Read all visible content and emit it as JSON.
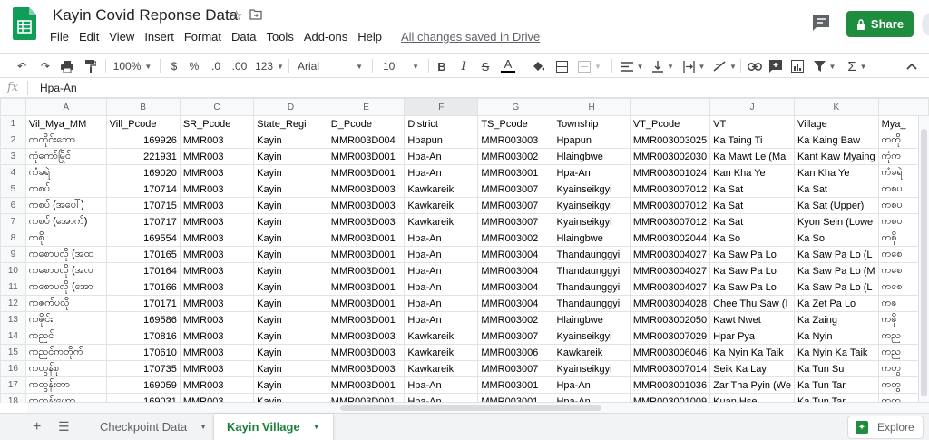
{
  "header": {
    "title": "Kayin Covid Reponse Data",
    "menu": [
      "File",
      "Edit",
      "View",
      "Insert",
      "Format",
      "Data",
      "Tools",
      "Add-ons",
      "Help"
    ],
    "saved_status": "All changes saved in Drive",
    "share_label": "Share",
    "icons": [
      "star-icon",
      "move-folder-icon",
      "comment-icon",
      "lock-icon"
    ]
  },
  "toolbar": {
    "zoom": "100%",
    "currency": "$",
    "percent": "%",
    "decrease_decimal": ".0",
    "increase_decimal": ".00",
    "more_formats": "123",
    "font": "Arial",
    "font_size": "10",
    "bold": "B",
    "italic": "I",
    "strike": "S",
    "text_color": "A",
    "functions": "Σ"
  },
  "formula_bar": {
    "fx_label": "fx",
    "value": "Hpa-An"
  },
  "grid": {
    "column_letters": [
      "A",
      "B",
      "C",
      "D",
      "E",
      "F",
      "G",
      "H",
      "I",
      "J",
      "K",
      ""
    ],
    "selected_column": "F",
    "row_numbers": [
      "1",
      "2",
      "3",
      "4",
      "5",
      "6",
      "7",
      "8",
      "9",
      "10",
      "11",
      "12",
      "13",
      "14",
      "15",
      "16",
      "17",
      "18"
    ],
    "rows": [
      [
        "Vil_Mya_MM",
        "Vill_Pcode",
        "SR_Pcode",
        "State_Regi",
        "D_Pcode",
        "District",
        "TS_Pcode",
        "Township",
        "VT_Pcode",
        "VT",
        "Village",
        "Mya_"
      ],
      [
        "ကကိုင်းဘော",
        "169926",
        "MMR003",
        "Kayin",
        "MMR003D004",
        "Hpapun",
        "MMR003003",
        "Hpapun",
        "MMR003003025",
        "Ka Taing Ti",
        "Ka Kaing Baw",
        "ကကို"
      ],
      [
        "ကုံကော်မြိုင်",
        "221931",
        "MMR003",
        "Kayin",
        "MMR003D001",
        "Hpa-An",
        "MMR003002",
        "Hlaingbwe",
        "MMR003002030",
        "Ka Mawt Le (Ma",
        "Kant Kaw Myaing",
        "ကုံက"
      ],
      [
        "ကံခရဲ",
        "169020",
        "MMR003",
        "Kayin",
        "MMR003D001",
        "Hpa-An",
        "MMR003001",
        "Hpa-An",
        "MMR003001024",
        "Kan Kha Ye",
        "Kan Kha Ye",
        "ကံခရဲ"
      ],
      [
        "ကစပ်",
        "170714",
        "MMR003",
        "Kayin",
        "MMR003D003",
        "Kawkareik",
        "MMR003007",
        "Kyainseikgyi",
        "MMR003007012",
        "Ka Sat",
        "Ka Sat",
        "ကစပ"
      ],
      [
        "ကစပ် (အပေါ်)",
        "170715",
        "MMR003",
        "Kayin",
        "MMR003D003",
        "Kawkareik",
        "MMR003007",
        "Kyainseikgyi",
        "MMR003007012",
        "Ka Sat",
        "Ka Sat (Upper)",
        "ကစပ"
      ],
      [
        "ကစပ် (အောက်)",
        "170717",
        "MMR003",
        "Kayin",
        "MMR003D003",
        "Kawkareik",
        "MMR003007",
        "Kyainseikgyi",
        "MMR003007012",
        "Ka Sat",
        "Kyon Sein (Lowe",
        "ကစပ"
      ],
      [
        "ကစို",
        "169554",
        "MMR003",
        "Kayin",
        "MMR003D001",
        "Hpa-An",
        "MMR003002",
        "Hlaingbwe",
        "MMR003002044",
        "Ka So",
        "Ka So",
        "ကစို"
      ],
      [
        "ကစောပလို (အထ",
        "170165",
        "MMR003",
        "Kayin",
        "MMR003D001",
        "Hpa-An",
        "MMR003004",
        "Thandaunggyi",
        "MMR003004027",
        "Ka Saw Pa Lo",
        "Ka Saw Pa Lo (L",
        "ကစေ"
      ],
      [
        "ကစောပလို (အလ",
        "170164",
        "MMR003",
        "Kayin",
        "MMR003D001",
        "Hpa-An",
        "MMR003004",
        "Thandaunggyi",
        "MMR003004027",
        "Ka Saw Pa Lo",
        "Ka Saw Pa Lo (M",
        "ကစေ"
      ],
      [
        "ကစောပလို (အော",
        "170166",
        "MMR003",
        "Kayin",
        "MMR003D001",
        "Hpa-An",
        "MMR003004",
        "Thandaunggyi",
        "MMR003004027",
        "Ka Saw Pa Lo",
        "Ka Saw Pa Lo (L",
        "ကစေ"
      ],
      [
        "ကဇက်ပလို",
        "170171",
        "MMR003",
        "Kayin",
        "MMR003D001",
        "Hpa-An",
        "MMR003004",
        "Thandaunggyi",
        "MMR003004028",
        "Chee Thu Saw (I",
        "Ka Zet Pa Lo",
        "ကဇ"
      ],
      [
        "ကဇိုင်း",
        "169586",
        "MMR003",
        "Kayin",
        "MMR003D001",
        "Hpa-An",
        "MMR003002",
        "Hlaingbwe",
        "MMR003002050",
        "Kawt Nwet",
        "Ka Zaing",
        "ကဇို"
      ],
      [
        "ကညင်",
        "170816",
        "MMR003",
        "Kayin",
        "MMR003D003",
        "Kawkareik",
        "MMR003007",
        "Kyainseikgyi",
        "MMR003007029",
        "Hpar Pya",
        "Ka Nyin",
        "ကည"
      ],
      [
        "ကညင်ကတိုက်",
        "170610",
        "MMR003",
        "Kayin",
        "MMR003D003",
        "Kawkareik",
        "MMR003006",
        "Kawkareik",
        "MMR003006046",
        "Ka Nyin Ka Taik",
        "Ka Nyin Ka Taik",
        "ကည"
      ],
      [
        "ကတွန်စု",
        "170735",
        "MMR003",
        "Kayin",
        "MMR003D003",
        "Kawkareik",
        "MMR003007",
        "Kyainseikgyi",
        "MMR003007014",
        "Seik Ka Lay",
        "Ka Tun Su",
        "ကတွ"
      ],
      [
        "ကတွန်းတာ",
        "169059",
        "MMR003",
        "Kayin",
        "MMR003D001",
        "Hpa-An",
        "MMR003001",
        "Hpa-An",
        "MMR003001036",
        "Zar Tha Pyin (We",
        "Ka Tun Tar",
        "ကတွ"
      ],
      [
        "ကတွန်းဟော",
        "169031",
        "MMR003",
        "Kayin",
        "MMR003D001",
        "Hpa-An",
        "MMR003001",
        "Hpa-An",
        "MMR003001009",
        "Kuan Hse",
        "Ka Tun Tar",
        "ကတွ"
      ]
    ]
  },
  "sheets": {
    "tabs": [
      "Checkpoint Data",
      "Kayin Village"
    ],
    "active": "Kayin Village",
    "explore_label": "Explore"
  },
  "colors": {
    "share_green": "#1e8e3e",
    "active_tab": "#188038",
    "header_bg": "#f8f9fa"
  }
}
